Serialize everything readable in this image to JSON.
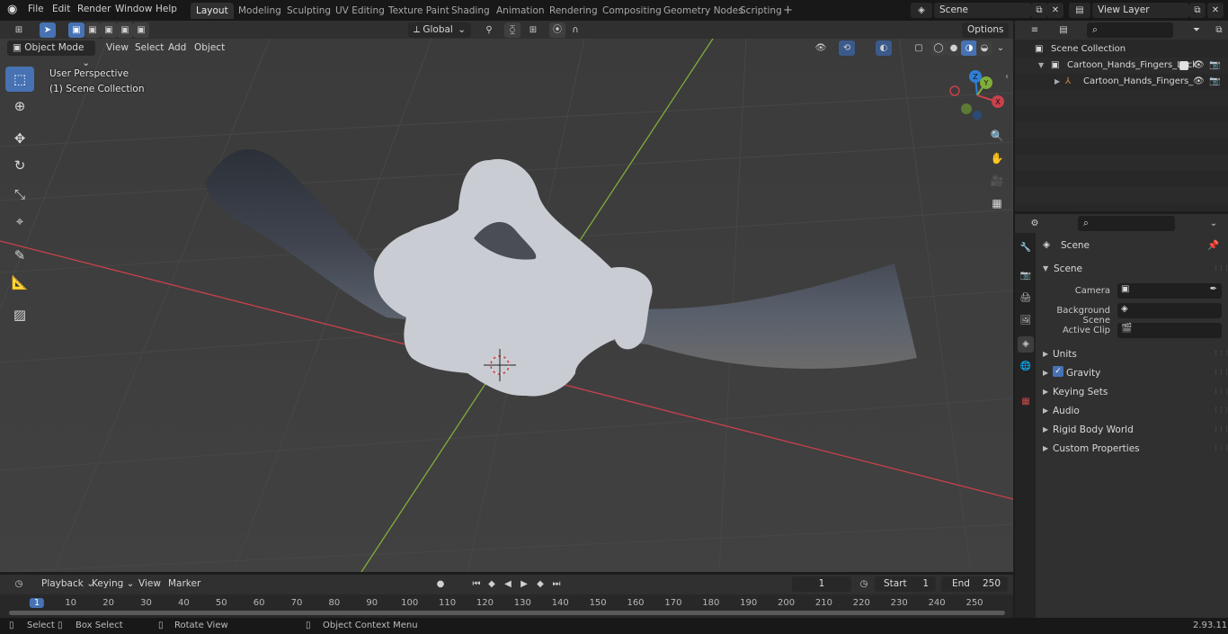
{
  "menu": {
    "file": "File",
    "edit": "Edit",
    "render": "Render",
    "window": "Window",
    "help": "Help"
  },
  "workspaces": [
    "Layout",
    "Modeling",
    "Sculpting",
    "UV Editing",
    "Texture Paint",
    "Shading",
    "Animation",
    "Rendering",
    "Compositing",
    "Geometry Nodes",
    "Scripting"
  ],
  "scene": {
    "name": "Scene",
    "view_layer": "View Layer"
  },
  "viewport_header": {
    "mode": "Object Mode",
    "view": "View",
    "select": "Select",
    "add": "Add",
    "object": "Object",
    "transform_orientation": "Global",
    "options": "Options"
  },
  "viewport_overlay": {
    "perspective": "User Perspective",
    "collection": "(1) Scene Collection"
  },
  "gizmo": {
    "z": "Z",
    "y": "Y",
    "x": "X"
  },
  "outliner": {
    "root": "Scene Collection",
    "items": [
      {
        "label": "Cartoon_Hands_Fingers_Lock"
      },
      {
        "label": "Cartoon_Hands_Fingers_"
      }
    ]
  },
  "properties": {
    "context": "Scene",
    "panel_title": "Scene",
    "camera_label": "Camera",
    "background_scene_label": "Background Scene",
    "active_clip_label": "Active Clip",
    "sections": [
      "Units",
      "Gravity",
      "Keying Sets",
      "Audio",
      "Rigid Body World",
      "Custom Properties"
    ],
    "gravity_checked": true
  },
  "timeline": {
    "playback": "Playback",
    "keying": "Keying",
    "view": "View",
    "marker": "Marker",
    "current_frame": "1",
    "start_label": "Start",
    "start_value": "1",
    "end_label": "End",
    "end_value": "250",
    "ticks": [
      "1",
      "10",
      "20",
      "30",
      "40",
      "50",
      "60",
      "70",
      "80",
      "90",
      "100",
      "110",
      "120",
      "130",
      "140",
      "150",
      "160",
      "170",
      "180",
      "190",
      "200",
      "210",
      "220",
      "230",
      "240",
      "250"
    ]
  },
  "statusbar": {
    "select": "Select",
    "box_select": "Box Select",
    "rotate_view": "Rotate View",
    "context_menu": "Object Context Menu",
    "version": "2.93.11"
  },
  "colors": {
    "accent": "#4772b3",
    "x_axis": "#c8414b",
    "y_axis": "#7fad3a",
    "z_axis": "#2f7fd6",
    "grid_bg": "#3d3d3d"
  }
}
